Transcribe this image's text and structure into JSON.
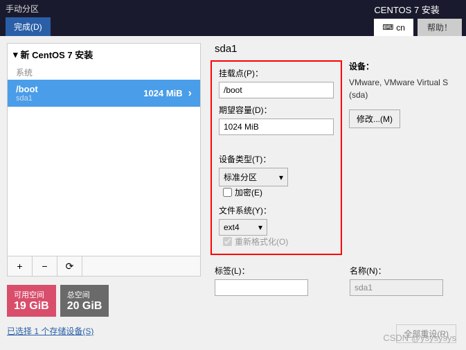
{
  "topbar": {
    "title": "手动分区",
    "done": "完成(D)",
    "install_title": "CENTOS 7 安装",
    "lang": "cn",
    "help": "帮助！"
  },
  "left": {
    "header": "新 CentOS 7 安装",
    "section": "系统",
    "partition": {
      "name": "/boot",
      "dev": "sda1",
      "size": "1024 MiB"
    },
    "buttons": {
      "add": "+",
      "remove": "−",
      "reload": "⟳"
    },
    "avail": {
      "label": "可用空间",
      "value": "19 GiB"
    },
    "total": {
      "label": "总空间",
      "value": "20 GiB"
    },
    "storage_link": "已选择 1 个存储设备(S)"
  },
  "right": {
    "title": "sda1",
    "mount_label": "挂载点(P)：",
    "mount_value": "/boot",
    "capacity_label": "期望容量(D)：",
    "capacity_value": "1024 MiB",
    "devtype_label": "设备类型(T)：",
    "devtype_value": "标准分区",
    "encrypt": "加密(E)",
    "fs_label": "文件系统(Y)：",
    "fs_value": "ext4",
    "reformat": "重新格式化(O)",
    "label_label": "标签(L)：",
    "name_label": "名称(N)：",
    "name_value": "sda1",
    "device_hdr": "设备：",
    "device_info1": "VMware, VMware Virtual S",
    "device_info2": "(sda)",
    "modify": "修改...(M)"
  },
  "footer": {
    "watermark": "CSDN @ysysysys",
    "reset": "全部重设(R)"
  }
}
